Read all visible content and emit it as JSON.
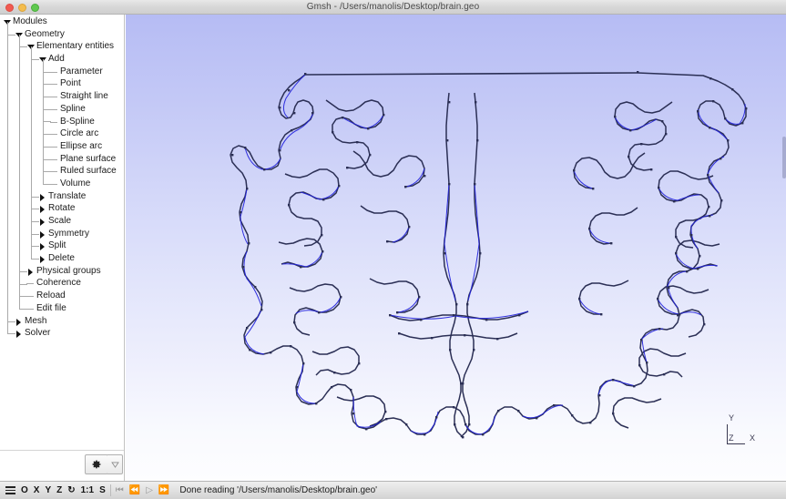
{
  "window": {
    "title": "Gmsh - /Users/manolis/Desktop/brain.geo",
    "controls": {
      "close": "close",
      "minimize": "minimize",
      "maximize": "maximize"
    }
  },
  "sidebar": {
    "tree": [
      {
        "label": "Modules",
        "depth": 0,
        "state": "open"
      },
      {
        "label": "Geometry",
        "depth": 1,
        "state": "open"
      },
      {
        "label": "Elementary entities",
        "depth": 2,
        "state": "open"
      },
      {
        "label": "Add",
        "depth": 3,
        "state": "open"
      },
      {
        "label": "Parameter",
        "depth": 4,
        "state": "leaf"
      },
      {
        "label": "Point",
        "depth": 4,
        "state": "leaf"
      },
      {
        "label": "Straight line",
        "depth": 4,
        "state": "leaf"
      },
      {
        "label": "Spline",
        "depth": 4,
        "state": "leaf"
      },
      {
        "label": "B-Spline",
        "depth": 4,
        "state": "leaf"
      },
      {
        "label": "Circle arc",
        "depth": 4,
        "state": "leaf"
      },
      {
        "label": "Ellipse arc",
        "depth": 4,
        "state": "leaf"
      },
      {
        "label": "Plane surface",
        "depth": 4,
        "state": "leaf"
      },
      {
        "label": "Ruled surface",
        "depth": 4,
        "state": "leaf"
      },
      {
        "label": "Volume",
        "depth": 4,
        "state": "leaf"
      },
      {
        "label": "Translate",
        "depth": 3,
        "state": "closed"
      },
      {
        "label": "Rotate",
        "depth": 3,
        "state": "closed"
      },
      {
        "label": "Scale",
        "depth": 3,
        "state": "closed"
      },
      {
        "label": "Symmetry",
        "depth": 3,
        "state": "closed"
      },
      {
        "label": "Split",
        "depth": 3,
        "state": "closed"
      },
      {
        "label": "Delete",
        "depth": 3,
        "state": "closed"
      },
      {
        "label": "Physical groups",
        "depth": 2,
        "state": "closed"
      },
      {
        "label": "Coherence",
        "depth": 2,
        "state": "leaf"
      },
      {
        "label": "Reload",
        "depth": 2,
        "state": "leaf"
      },
      {
        "label": "Edit file",
        "depth": 2,
        "state": "leaf"
      },
      {
        "label": "Mesh",
        "depth": 1,
        "state": "closed"
      },
      {
        "label": "Solver",
        "depth": 1,
        "state": "closed"
      }
    ],
    "toolbar": {
      "gear_icon": "gear-icon",
      "dropdown_icon": "triangle-down-icon"
    }
  },
  "statusbar": {
    "buttons": [
      {
        "name": "menu",
        "label": "",
        "icon": "hamburger-icon",
        "dim": false
      },
      {
        "name": "view-o",
        "label": "O",
        "icon": "",
        "dim": false
      },
      {
        "name": "view-x",
        "label": "X",
        "icon": "",
        "dim": false
      },
      {
        "name": "view-y",
        "label": "Y",
        "icon": "",
        "dim": false
      },
      {
        "name": "view-z",
        "label": "Z",
        "icon": "",
        "dim": false
      },
      {
        "name": "rotate",
        "label": "↻",
        "icon": "rotate-icon",
        "dim": false
      },
      {
        "name": "scale-ratio",
        "label": "1:1",
        "icon": "",
        "dim": false
      },
      {
        "name": "snapshot",
        "label": "S",
        "icon": "",
        "dim": false
      },
      {
        "name": "skip-back",
        "label": "⏮",
        "icon": "skip-back-icon",
        "dim": true
      },
      {
        "name": "rewind",
        "label": "⏪",
        "icon": "rewind-icon",
        "dim": true
      },
      {
        "name": "play",
        "label": "▷",
        "icon": "play-icon",
        "dim": true
      },
      {
        "name": "fast-forward",
        "label": "⏩",
        "icon": "forward-icon",
        "dim": true
      }
    ],
    "message": "Done reading '/Users/manolis/Desktop/brain.geo'"
  },
  "canvas": {
    "axis_triad": {
      "y": "Y",
      "z": "Z",
      "x": "X"
    },
    "colors": {
      "curve": "#2b2f55",
      "spline": "#2222dd",
      "bg_top": "#b6bcf4",
      "bg_bottom": "#fdfdff"
    },
    "geometry_name": "brain"
  }
}
